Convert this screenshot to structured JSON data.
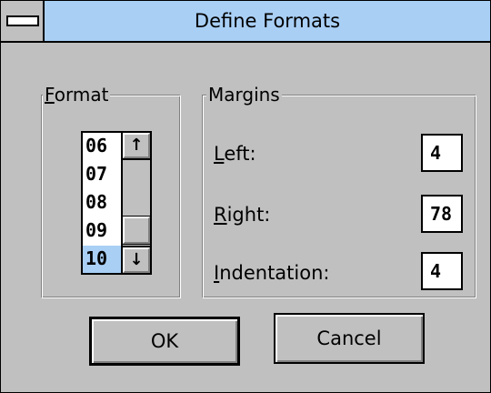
{
  "window": {
    "title": "Define Formats"
  },
  "format_group": {
    "label_underlined": "F",
    "label_rest": "ormat",
    "items": [
      "06",
      "07",
      "08",
      "09",
      "10"
    ],
    "selected": "10",
    "scroll_up_glyph": "↑",
    "scroll_down_glyph": "↓"
  },
  "margins_group": {
    "label": "Margins",
    "left": {
      "label_underlined": "L",
      "label_rest": "eft:",
      "value": "4"
    },
    "right": {
      "label_underlined": "R",
      "label_rest": "ight:",
      "value": "78"
    },
    "indentation": {
      "label_underlined": "I",
      "label_rest": "ndentation:",
      "value": "4"
    }
  },
  "buttons": {
    "ok": "OK",
    "cancel": "Cancel"
  },
  "colors": {
    "title_bar": "#a9cff5",
    "selection": "#a9cff5",
    "face": "#c0c0c0"
  },
  "icons": {
    "system_menu": "system-menu-icon",
    "scroll_up": "arrow-up-icon",
    "scroll_down": "arrow-down-icon"
  }
}
